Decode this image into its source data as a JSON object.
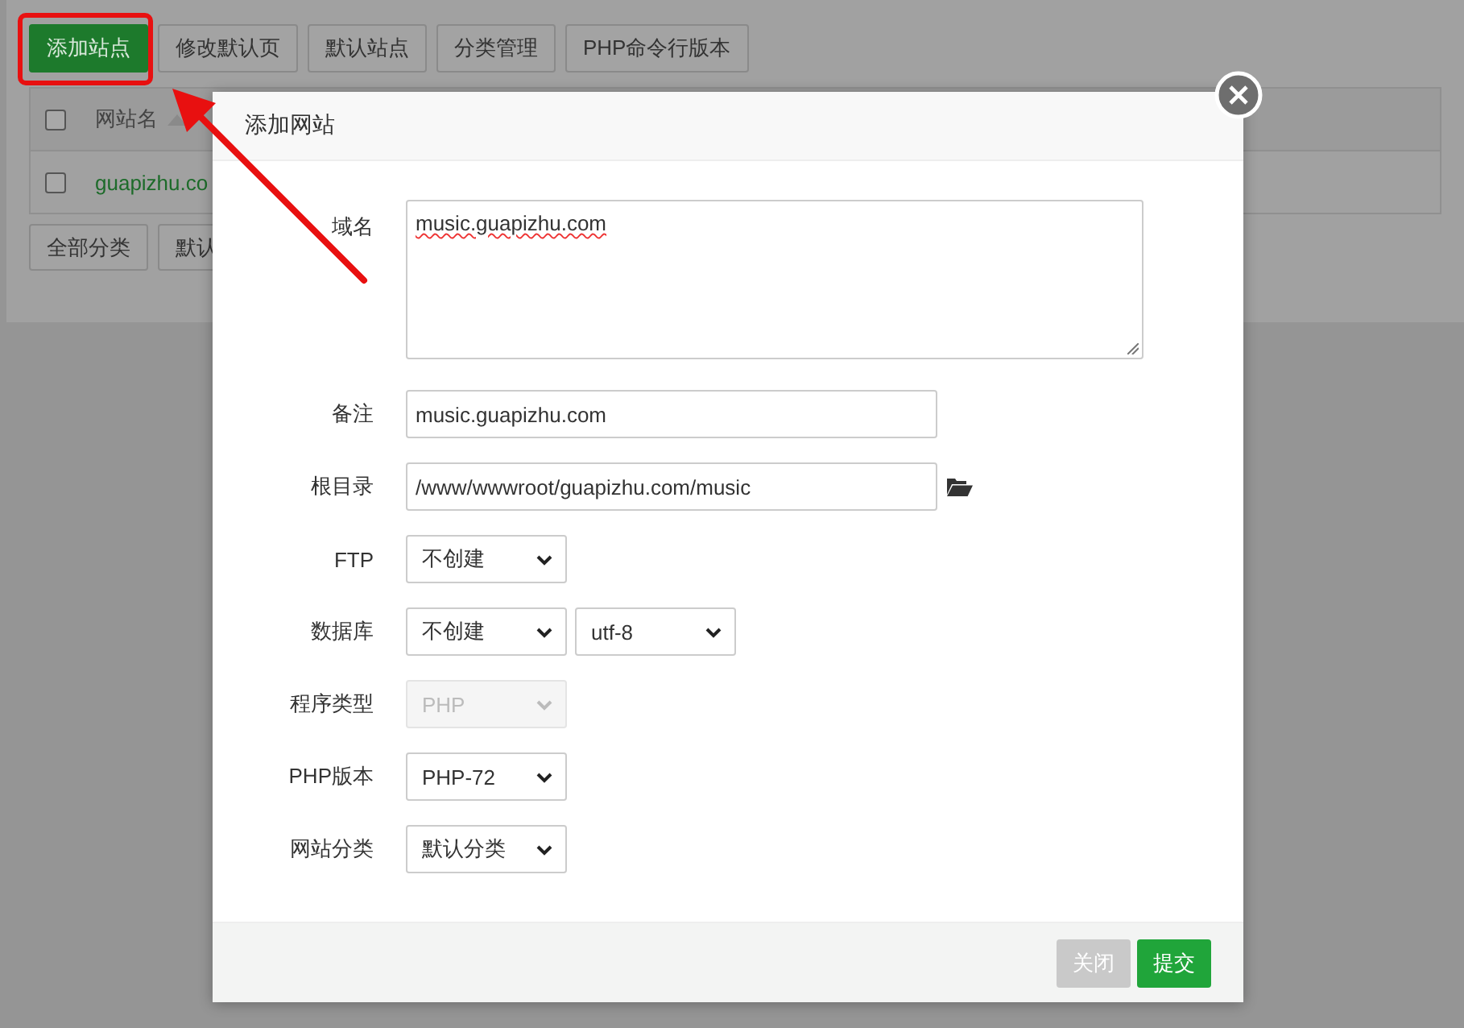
{
  "toolbar": [
    {
      "label": "添加站点",
      "kind": "primary"
    },
    {
      "label": "修改默认页",
      "kind": "default"
    },
    {
      "label": "默认站点",
      "kind": "default"
    },
    {
      "label": "分类管理",
      "kind": "default"
    },
    {
      "label": "PHP命令行版本",
      "kind": "default"
    }
  ],
  "table": {
    "header": {
      "label": "网站名",
      "checked": false
    },
    "rows": [
      {
        "name": "guapizhu.co",
        "checked": false
      }
    ]
  },
  "category_buttons": [
    "全部分类",
    "默认"
  ],
  "dialog": {
    "title": "添加网站",
    "fields": [
      {
        "label": "域名",
        "kind": "textarea",
        "value": "music.guapizhu.com"
      },
      {
        "label": "备注",
        "kind": "input",
        "value": "music.guapizhu.com"
      },
      {
        "label": "根目录",
        "kind": "path",
        "value": "/www/wwwroot/guapizhu.com/music"
      },
      {
        "label": "FTP",
        "kind": "select",
        "selects": [
          {
            "value": "不创建",
            "disabled": false
          }
        ]
      },
      {
        "label": "数据库",
        "kind": "select",
        "selects": [
          {
            "value": "不创建",
            "disabled": false
          },
          {
            "value": "utf-8",
            "disabled": false
          }
        ]
      },
      {
        "label": "程序类型",
        "kind": "select",
        "selects": [
          {
            "value": "PHP",
            "disabled": true
          }
        ]
      },
      {
        "label": "PHP版本",
        "kind": "select",
        "selects": [
          {
            "value": "PHP-72",
            "disabled": false
          }
        ]
      },
      {
        "label": "网站分类",
        "kind": "select",
        "selects": [
          {
            "value": "默认分类",
            "disabled": false
          }
        ]
      }
    ],
    "buttons": [
      {
        "label": "关闭",
        "kind": "secondary"
      },
      {
        "label": "提交",
        "kind": "primary"
      }
    ]
  }
}
